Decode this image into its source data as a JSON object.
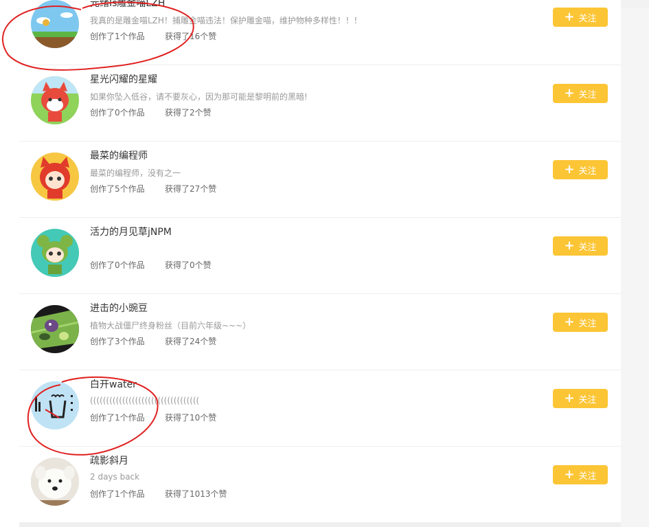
{
  "follow_label": "关注",
  "plus_glyph": "+",
  "colors": {
    "button": "#fcc535",
    "annotation": "#e02020"
  },
  "users": [
    {
      "name": "元绪Is雕金喵LZH",
      "bio": "我真的是雕金喵LZH！捕雕金喵违法！保护雕金喵，维护物种多样性！！！",
      "works": "创作了1个作品",
      "likes": "获得了16个赞",
      "avatar": "sky-landscape-icon"
    },
    {
      "name": "星光闪耀的星耀",
      "bio": "如果你坠入低谷，请不要灰心，因为那可能是黎明前的黑暗!",
      "works": "创作了0个作品",
      "likes": "获得了2个赞",
      "avatar": "red-fox-cartoon-icon"
    },
    {
      "name": "最菜的编程师",
      "bio": "最菜的编程师，没有之一",
      "works": "创作了5个作品",
      "likes": "获得了27个赞",
      "avatar": "fox-hood-cartoon-icon"
    },
    {
      "name": "活力的月见草jNPM",
      "bio": "",
      "works": "创作了0个作品",
      "likes": "获得了0个赞",
      "avatar": "green-bear-cartoon-icon"
    },
    {
      "name": "进击的小豌豆",
      "bio": "植物大战僵尸终身粉丝（目前六年级~~~）",
      "works": "创作了3个作品",
      "likes": "获得了24个赞",
      "avatar": "zombie-game-icon"
    },
    {
      "name": "白开water",
      "bio": "((((((((((((((((((((((((((((((((((",
      "works": "创作了1个作品",
      "likes": "获得了10个赞",
      "avatar": "water-cup-icon"
    },
    {
      "name": "疏影斜月",
      "bio": "2 days back",
      "works": "创作了1个作品",
      "likes": "获得了1013个赞",
      "avatar": "white-dog-icon"
    }
  ]
}
